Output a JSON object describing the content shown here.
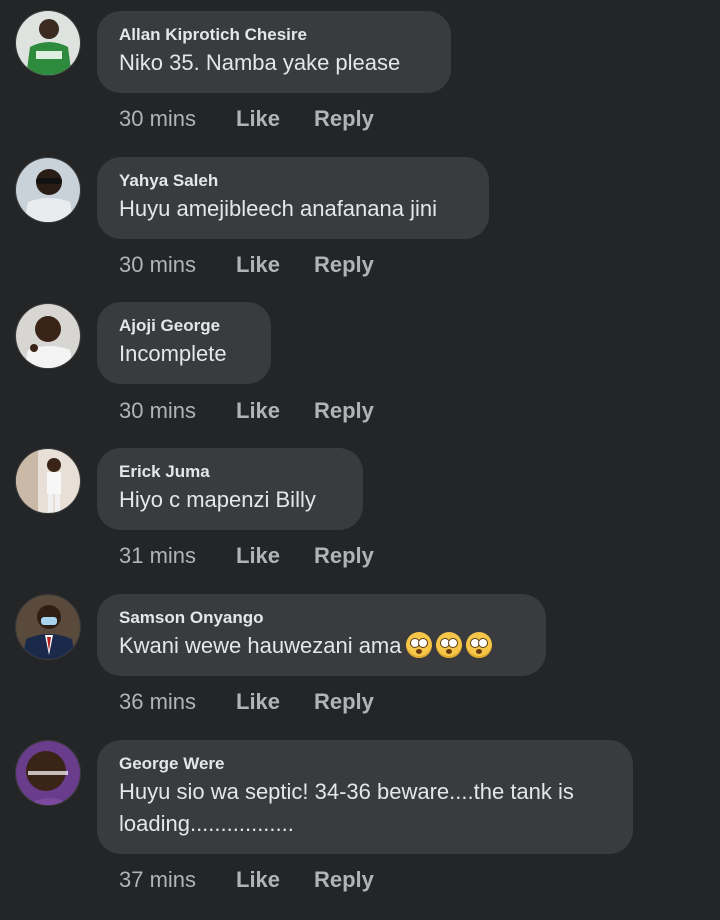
{
  "comments": [
    {
      "name": "Allan Kiprotich Chesire",
      "text": "Niko 35. Namba yake please",
      "time": "30 mins",
      "like": "Like",
      "reply": "Reply",
      "avatar": "avatar-green-shirt"
    },
    {
      "name": "Yahya Saleh",
      "text": "Huyu amejibleech anafanana jini",
      "time": "30 mins",
      "like": "Like",
      "reply": "Reply",
      "avatar": "avatar-sunglasses"
    },
    {
      "name": "Ajoji George",
      "text": "Incomplete",
      "time": "30 mins",
      "like": "Like",
      "reply": "Reply",
      "avatar": "avatar-white-shirt"
    },
    {
      "name": "Erick Juma",
      "text": "Hiyo c mapenzi Billy",
      "time": "31 mins",
      "like": "Like",
      "reply": "Reply",
      "avatar": "avatar-standing"
    },
    {
      "name": "Samson Onyango",
      "text": "Kwani wewe hauwezani ama",
      "time": "36 mins",
      "like": "Like",
      "reply": "Reply",
      "avatar": "avatar-suit-mask",
      "emojis": [
        "flushed-face",
        "flushed-face",
        "flushed-face"
      ]
    },
    {
      "name": "George Were",
      "text": "Huyu sio wa septic! 34-36 beware....the tank is\nloading.................",
      "time": "37 mins",
      "like": "Like",
      "reply": "Reply",
      "avatar": "avatar-purple"
    }
  ]
}
